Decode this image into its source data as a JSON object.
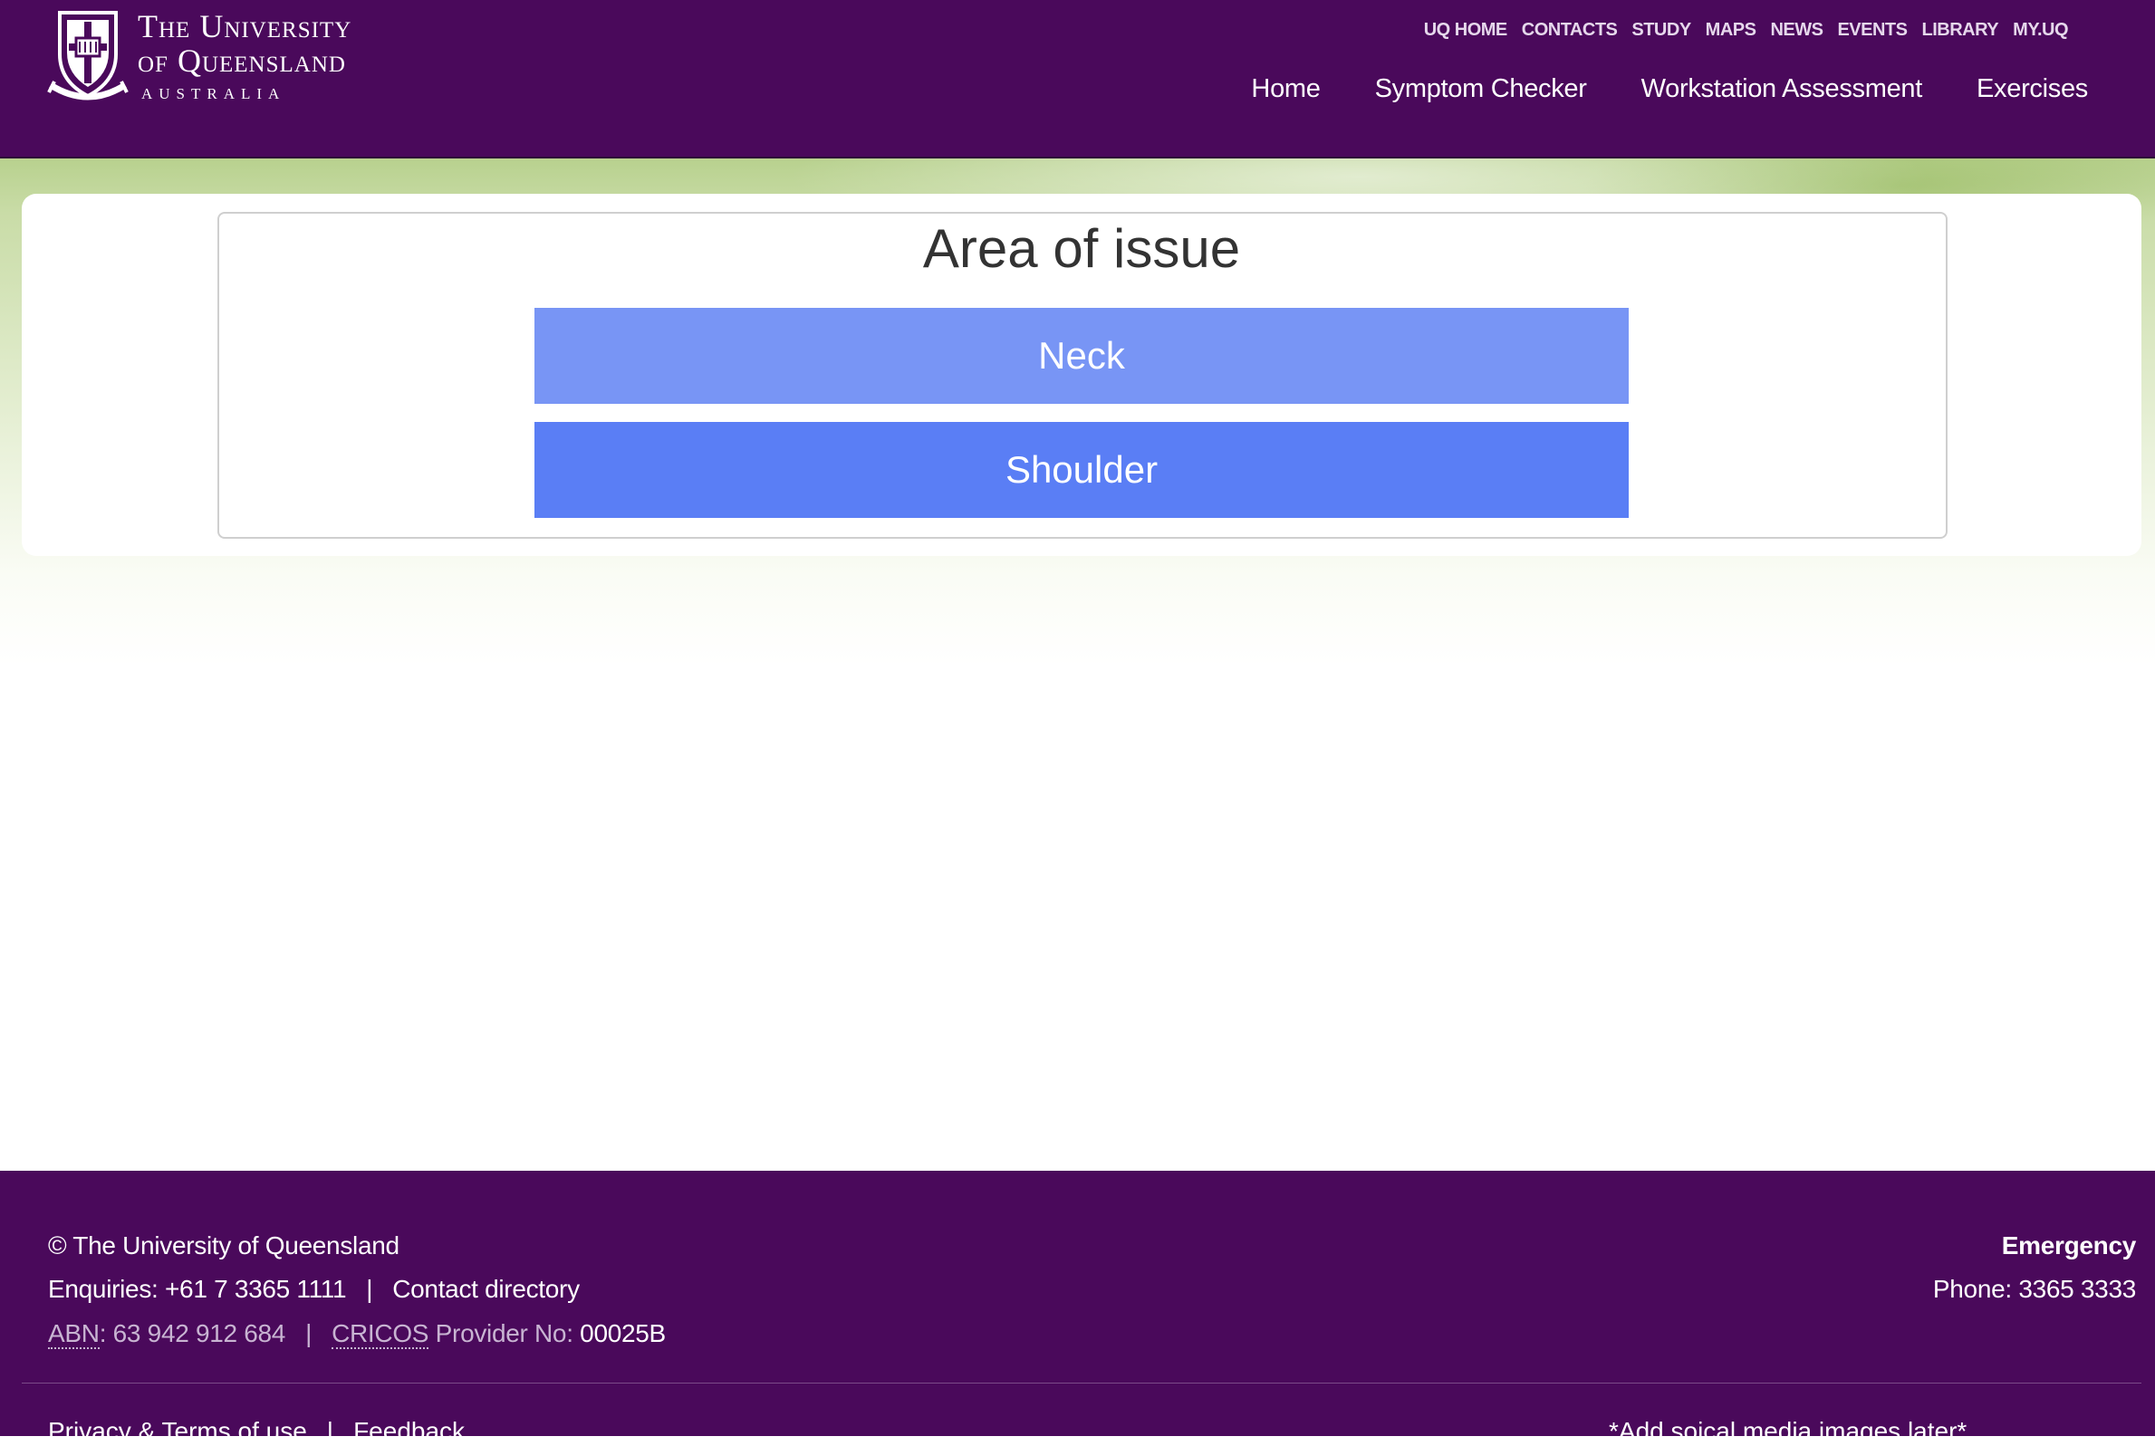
{
  "header": {
    "logo": {
      "line1": "The University",
      "line2": "of Queensland",
      "line3": "AUSTRALIA"
    },
    "top_links": [
      "UQ HOME",
      "CONTACTS",
      "STUDY",
      "MAPS",
      "NEWS",
      "EVENTS",
      "LIBRARY",
      "MY.UQ"
    ],
    "main_nav": [
      "Home",
      "Symptom Checker",
      "Workstation Assessment",
      "Exercises"
    ]
  },
  "main": {
    "title": "Area of issue",
    "options": [
      "Neck",
      "Shoulder"
    ]
  },
  "footer": {
    "copyright": "© The University of Queensland",
    "enquiries": "Enquiries: +61 7 3365 1111",
    "contact_directory": "Contact directory",
    "abn_label": "ABN",
    "abn_value": ": 63 942 912 684",
    "cricos_label": "CRICOS",
    "cricos_text": " Provider No: ",
    "cricos_value": "00025B",
    "emergency_label": "Emergency",
    "emergency_phone": "Phone: 3365 3333",
    "privacy": "Privacy & Terms of use",
    "feedback": "Feedback",
    "social_note": "*Add soical media images later*",
    "separator": "|"
  },
  "colors": {
    "brand_purple": "#4a095b",
    "neck_button": "#7895f5",
    "shoulder_button": "#5a7ef5"
  }
}
